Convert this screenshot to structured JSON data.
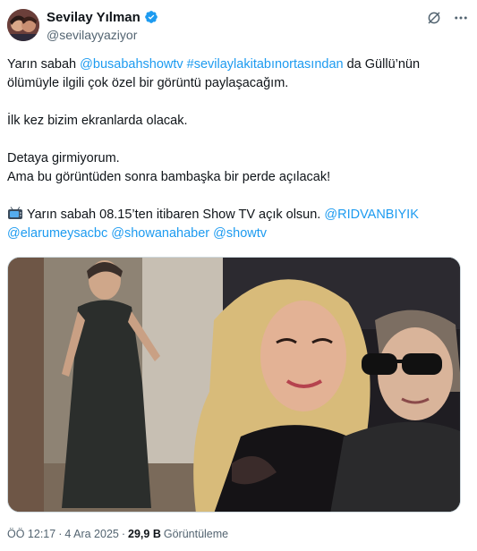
{
  "author": {
    "display_name": "Sevilay Yılman",
    "handle": "@sevilayyaziyor",
    "verified": true
  },
  "colors": {
    "link": "#1d9bf0",
    "secondary_text": "#536471",
    "verified_badge": "#1d9bf0"
  },
  "icons": {
    "header_actions": [
      "grok-icon",
      "more-icon"
    ],
    "emoji": "television-emoji"
  },
  "tweet": {
    "line1_prefix": "Yarın sabah ",
    "mention_busabah": "@busabahshowtv",
    "hashtag": "#sevilaylakitabınortasından",
    "line1_suffix": " da Güllü’nün",
    "line2": "ölümüyle ilgili çok özel bir görüntü paylaşacağım.",
    "para2": "İlk kez bizim ekranlarda olacak.",
    "para3_line1": "Detaya girmiyorum.",
    "para3_line2": "Ama bu görüntüden sonra bambaşka bir perde açılacak!",
    "para4_text": "Yarın sabah 08.15’ten itibaren Show TV açık olsun. ",
    "mention_ridvan": "@RIDVANBIYIK",
    "mention_elarum": "@elarumeysacbc",
    "mention_showana": "@showanahaber",
    "mention_showtv": "@showtv"
  },
  "footer": {
    "time": "ÖÖ 12:17",
    "separator": "·",
    "date": "4 Ara 2025",
    "views_count": "29,9 B",
    "views_label": "Görüntüleme"
  }
}
